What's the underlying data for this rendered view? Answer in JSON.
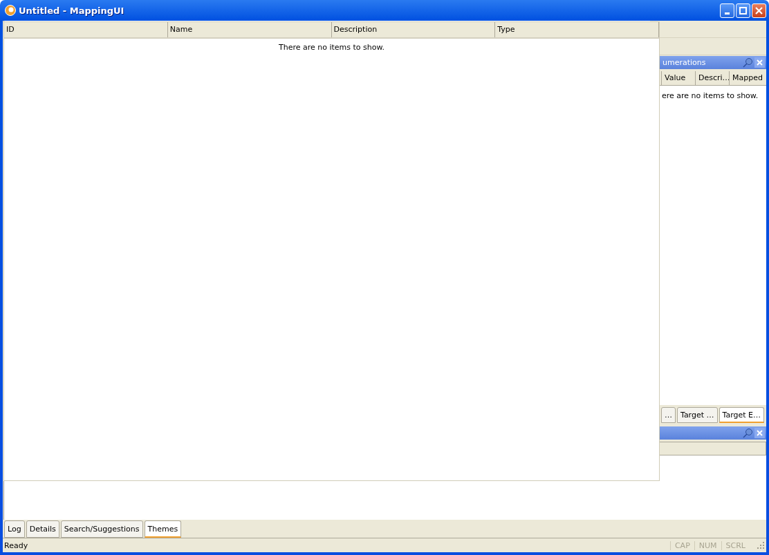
{
  "window": {
    "title": "Untitled - MappingUI"
  },
  "main_list": {
    "columns": [
      "ID",
      "Name",
      "Description",
      "Type"
    ],
    "empty_text": "There are no items to show."
  },
  "dock_panel": {
    "title": "umerations",
    "columns": [
      "Value",
      "Descri…",
      "Mapped"
    ],
    "empty_text": "ere are no items to show.",
    "tabs": [
      {
        "label": "…",
        "selected": false
      },
      {
        "label": "Target …",
        "selected": false
      },
      {
        "label": "Target E…",
        "selected": true
      }
    ]
  },
  "bottom_tabs": [
    {
      "label": "Log",
      "selected": false
    },
    {
      "label": "Details",
      "selected": false
    },
    {
      "label": "Search/Suggestions",
      "selected": false
    },
    {
      "label": "Themes",
      "selected": true
    }
  ],
  "status_bar": {
    "text": "Ready",
    "indicators": [
      {
        "label": "CAP",
        "active": false
      },
      {
        "label": "NUM",
        "active": false
      },
      {
        "label": "SCRL",
        "active": false
      }
    ]
  }
}
